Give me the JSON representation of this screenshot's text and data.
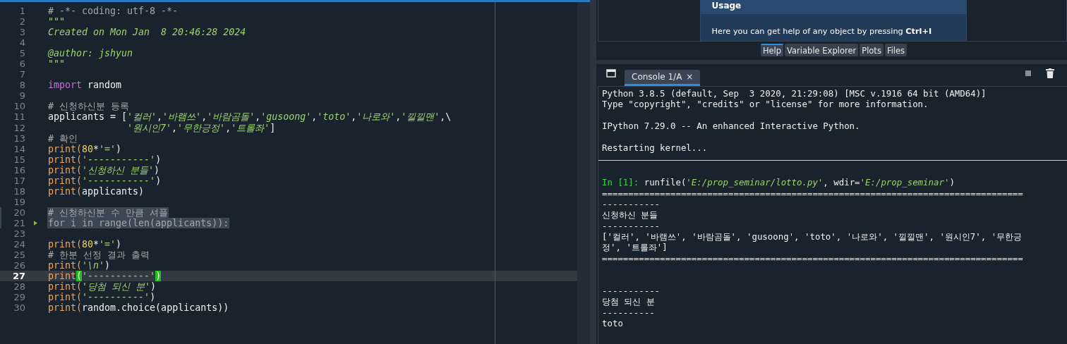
{
  "editor": {
    "lines": [
      {
        "number": "1",
        "current": false,
        "selected": false,
        "folded": false,
        "tokens": [
          {
            "kind": "comment",
            "text": "# -*- coding: utf-8 -*-"
          }
        ]
      },
      {
        "number": "2",
        "current": false,
        "selected": false,
        "folded": false,
        "tokens": [
          {
            "kind": "doc",
            "text": "\"\"\""
          }
        ]
      },
      {
        "number": "3",
        "current": false,
        "selected": false,
        "folded": false,
        "tokens": [
          {
            "kind": "doc",
            "text": "Created on Mon Jan  8 20:46:28 2024"
          }
        ]
      },
      {
        "number": "4",
        "current": false,
        "selected": false,
        "folded": false
      },
      {
        "number": "5",
        "current": false,
        "selected": false,
        "folded": false,
        "tokens": [
          {
            "kind": "doc",
            "text": "@author: jshyun"
          }
        ]
      },
      {
        "number": "6",
        "current": false,
        "selected": false,
        "folded": false,
        "tokens": [
          {
            "kind": "doc",
            "text": "\"\"\""
          }
        ]
      },
      {
        "number": "7",
        "current": false,
        "selected": false,
        "folded": false
      },
      {
        "number": "8",
        "current": false,
        "selected": false,
        "folded": false,
        "tokens": [
          {
            "kind": "keyword",
            "text": "import"
          },
          {
            "kind": "plain",
            "text": " random"
          }
        ]
      },
      {
        "number": "9",
        "current": false,
        "selected": false,
        "folded": false
      },
      {
        "number": "10",
        "current": false,
        "selected": false,
        "folded": false,
        "tokens": [
          {
            "kind": "comment",
            "text": "# 신청하신분 등록"
          }
        ]
      },
      {
        "number": "11",
        "current": false,
        "selected": false,
        "folded": false,
        "tokens": [
          {
            "kind": "plain",
            "text": "applicants = ["
          },
          {
            "kind": "string",
            "text": "'컬러'"
          },
          {
            "kind": "plain",
            "text": ","
          },
          {
            "kind": "string",
            "text": "'바램쓰'"
          },
          {
            "kind": "plain",
            "text": ","
          },
          {
            "kind": "string",
            "text": "'바람곰돌'"
          },
          {
            "kind": "plain",
            "text": ","
          },
          {
            "kind": "string",
            "text": "'gusoong'"
          },
          {
            "kind": "plain",
            "text": ","
          },
          {
            "kind": "string",
            "text": "'toto'"
          },
          {
            "kind": "plain",
            "text": ","
          },
          {
            "kind": "string",
            "text": "'나로와'"
          },
          {
            "kind": "plain",
            "text": ","
          },
          {
            "kind": "string",
            "text": "'낄낄맨'"
          },
          {
            "kind": "plain",
            "text": ",\\"
          }
        ]
      },
      {
        "number": "12",
        "current": false,
        "selected": false,
        "folded": false,
        "hanging": true,
        "tokens": [
          {
            "kind": "string",
            "text": "'원시인7'"
          },
          {
            "kind": "plain",
            "text": ","
          },
          {
            "kind": "string",
            "text": "'무한긍정'"
          },
          {
            "kind": "plain",
            "text": ","
          },
          {
            "kind": "string",
            "text": "'트롤좌'"
          },
          {
            "kind": "plain",
            "text": "]"
          }
        ]
      },
      {
        "number": "13",
        "current": false,
        "selected": false,
        "folded": false,
        "tokens": [
          {
            "kind": "comment",
            "text": "# 확인"
          }
        ]
      },
      {
        "number": "14",
        "current": false,
        "selected": false,
        "folded": false,
        "tokens": [
          {
            "kind": "builtin",
            "text": "print("
          },
          {
            "kind": "number",
            "text": "80"
          },
          {
            "kind": "plain",
            "text": "*"
          },
          {
            "kind": "string",
            "text": "'='"
          },
          {
            "kind": "plain",
            "text": ")"
          }
        ]
      },
      {
        "number": "15",
        "current": false,
        "selected": false,
        "folded": false,
        "tokens": [
          {
            "kind": "builtin",
            "text": "print("
          },
          {
            "kind": "string",
            "text": "'-----------'"
          },
          {
            "kind": "plain",
            "text": ")"
          }
        ]
      },
      {
        "number": "16",
        "current": false,
        "selected": false,
        "folded": false,
        "tokens": [
          {
            "kind": "builtin",
            "text": "print("
          },
          {
            "kind": "string",
            "text": "'신청하신 분들'"
          },
          {
            "kind": "plain",
            "text": ")"
          }
        ]
      },
      {
        "number": "17",
        "current": false,
        "selected": false,
        "folded": false,
        "tokens": [
          {
            "kind": "builtin",
            "text": "print("
          },
          {
            "kind": "string",
            "text": "'-----------'"
          },
          {
            "kind": "plain",
            "text": ")"
          }
        ]
      },
      {
        "number": "18",
        "current": false,
        "selected": false,
        "folded": false,
        "tokens": [
          {
            "kind": "builtin",
            "text": "print("
          },
          {
            "kind": "plain",
            "text": "applicants)"
          }
        ]
      },
      {
        "number": "19",
        "current": false,
        "selected": false,
        "folded": false
      },
      {
        "number": "20",
        "current": false,
        "selected": true,
        "folded": false,
        "tokens": [
          {
            "kind": "comment",
            "text": "# 신청하신분 수 만큼 셔플"
          }
        ]
      },
      {
        "number": "21",
        "current": false,
        "selected": true,
        "folded": true,
        "tokens": [
          {
            "kind": "comment",
            "text": "for i in range(len(applicants)):"
          }
        ]
      },
      {
        "number": "23",
        "current": false,
        "selected": false,
        "folded": false
      },
      {
        "number": "24",
        "current": false,
        "selected": false,
        "folded": false,
        "tokens": [
          {
            "kind": "builtin",
            "text": "print("
          },
          {
            "kind": "number",
            "text": "80"
          },
          {
            "kind": "plain",
            "text": "*"
          },
          {
            "kind": "string",
            "text": "'='"
          },
          {
            "kind": "plain",
            "text": ")"
          }
        ]
      },
      {
        "number": "25",
        "current": false,
        "selected": false,
        "folded": false,
        "tokens": [
          {
            "kind": "comment",
            "text": "# 한분 선정 결과 출력"
          }
        ]
      },
      {
        "number": "26",
        "current": false,
        "selected": false,
        "folded": false,
        "tokens": [
          {
            "kind": "builtin",
            "text": "print("
          },
          {
            "kind": "string",
            "text": "'\\n'"
          },
          {
            "kind": "plain",
            "text": ")"
          }
        ]
      },
      {
        "number": "27",
        "current": true,
        "selected": false,
        "folded": false,
        "tokens": [
          {
            "kind": "builtin",
            "text": "print"
          },
          {
            "kind": "match",
            "text": "("
          },
          {
            "kind": "string",
            "text": "'-----------'"
          },
          {
            "kind": "match",
            "text": ")"
          }
        ]
      },
      {
        "number": "28",
        "current": false,
        "selected": false,
        "folded": false,
        "tokens": [
          {
            "kind": "builtin",
            "text": "print("
          },
          {
            "kind": "string",
            "text": "'당첨 되신 분'"
          },
          {
            "kind": "plain",
            "text": ")"
          }
        ]
      },
      {
        "number": "29",
        "current": false,
        "selected": false,
        "folded": false,
        "tokens": [
          {
            "kind": "builtin",
            "text": "print("
          },
          {
            "kind": "string",
            "text": "'----------'"
          },
          {
            "kind": "plain",
            "text": ")"
          }
        ]
      },
      {
        "number": "30",
        "current": false,
        "selected": false,
        "folded": false,
        "tokens": [
          {
            "kind": "builtin",
            "text": "print("
          },
          {
            "kind": "plain",
            "text": "random.choice(applicants))"
          }
        ]
      }
    ]
  },
  "help": {
    "title": "Usage",
    "text": "Here you can get help of any object by pressing **Ctrl+I**"
  },
  "pane_tabs": [
    {
      "label": "Help",
      "selected": true
    },
    {
      "label": "Variable Explorer",
      "selected": false
    },
    {
      "label": "Plots",
      "selected": false
    },
    {
      "label": "Files",
      "selected": false
    }
  ],
  "console": {
    "tabs": [
      {
        "label": "Console 1/A",
        "close": "×",
        "selected": true
      }
    ],
    "lines": [
      {
        "kind": "text",
        "text": "Python 3.8.5 (default, Sep  3 2020, 21:29:08) [MSC v.1916 64 bit (AMD64)]"
      },
      {
        "kind": "text",
        "text": "Type \"copyright\", \"credits\" or \"license\" for more information."
      },
      {
        "kind": "blank"
      },
      {
        "kind": "text",
        "text": "IPython 7.29.0 -- An enhanced Interactive Python."
      },
      {
        "kind": "blank"
      },
      {
        "kind": "text",
        "text": "Restarting kernel..."
      },
      {
        "kind": "rule"
      },
      {
        "kind": "blank"
      },
      {
        "kind": "input",
        "prompt": "In [1]:",
        "tokens": [
          {
            "kind": "plain",
            "text": " runfile("
          },
          {
            "kind": "string",
            "text": "'E:/prop_seminar/lotto.py'"
          },
          {
            "kind": "plain",
            "text": ", wdir="
          },
          {
            "kind": "string",
            "text": "'E:/prop_seminar'"
          },
          {
            "kind": "plain",
            "text": ")"
          }
        ]
      },
      {
        "kind": "text",
        "text": "================================================================================"
      },
      {
        "kind": "text",
        "text": "-----------"
      },
      {
        "kind": "text",
        "text": "신청하신 분들"
      },
      {
        "kind": "text",
        "text": "-----------"
      },
      {
        "kind": "text",
        "text": "['컬러', '바램쓰', '바람곰돌', 'gusoong', 'toto', '나로와', '낄낄맨', '원시인7', '무한긍"
      },
      {
        "kind": "text",
        "text": "정', '트롤좌']"
      },
      {
        "kind": "text",
        "text": "================================================================================"
      },
      {
        "kind": "blank"
      },
      {
        "kind": "blank"
      },
      {
        "kind": "text",
        "text": "-----------"
      },
      {
        "kind": "text",
        "text": "당첨 되신 분"
      },
      {
        "kind": "text",
        "text": "----------"
      },
      {
        "kind": "text",
        "text": "toto"
      }
    ]
  }
}
